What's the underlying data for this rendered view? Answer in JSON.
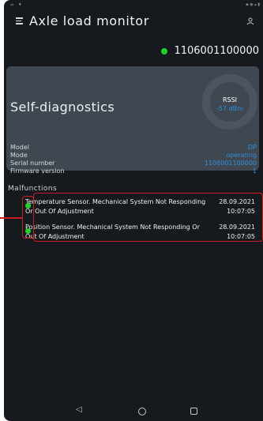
{
  "app": {
    "title": "Axle load monitor"
  },
  "device": {
    "id": "1106001100000",
    "status_color": "#1fd32a"
  },
  "diagnostics": {
    "title": "Self-diagnostics",
    "rssi_label": "RSSI",
    "rssi_value": "-57 dBm",
    "rows": [
      {
        "label": "Model",
        "value": "DP"
      },
      {
        "label": "Mode",
        "value": "operating"
      },
      {
        "label": "Serial number",
        "value": "1106001100000"
      },
      {
        "label": "Firmware version",
        "value": "1"
      }
    ]
  },
  "malfunctions": {
    "title": "Malfunctions",
    "items": [
      {
        "description": "Temperature Sensor. Mechanical System Not Responding Or Out Of Adjustment",
        "date": "28.09.2021",
        "time": "10:07:05",
        "status_color": "#1fd32a"
      },
      {
        "description": "Position Sensor. Mechanical System Not Responding Or Out Of Adjustment",
        "date": "28.09.2021",
        "time": "10:07:05",
        "status_color": "#1fd32a"
      }
    ]
  },
  "icons": {
    "menu": "menu-icon",
    "profile": "profile-icon",
    "back": "back-icon",
    "home": "home-icon",
    "recent": "recent-apps-icon"
  },
  "colors": {
    "accent": "#2e8fd9",
    "annotation": "#c81d22",
    "card": "#3f4751",
    "background": "#161a1f"
  }
}
